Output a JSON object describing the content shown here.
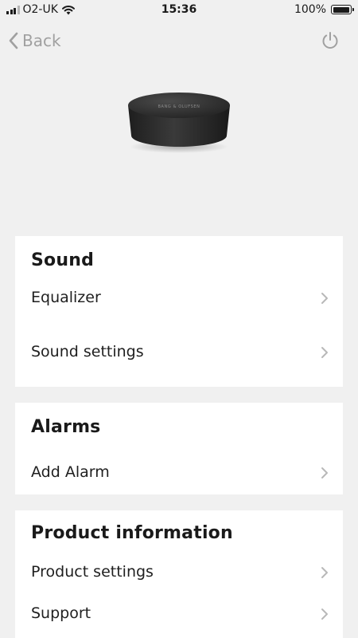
{
  "status_bar": {
    "carrier": "O2-UK",
    "time": "15:36",
    "battery_percent": "100%",
    "battery_level": 1.0,
    "signal_bars": 3,
    "icons": [
      "signal-icon",
      "wifi-icon",
      "battery-icon"
    ]
  },
  "nav": {
    "back_label": "Back",
    "power_icon": "power-icon",
    "back_icon": "chevron-left-icon",
    "color_muted": "#a0a0a0"
  },
  "product": {
    "brand_text": "BANG & OLUFSEN"
  },
  "sections": {
    "sound": {
      "title": "Sound",
      "items": [
        {
          "label": "Equalizer"
        },
        {
          "label": "Sound settings"
        }
      ]
    },
    "alarms": {
      "title": "Alarms",
      "items": [
        {
          "label": "Add Alarm"
        }
      ]
    },
    "product_information": {
      "title": "Product information",
      "items": [
        {
          "label": "Product settings"
        },
        {
          "label": "Support"
        }
      ]
    }
  },
  "colors": {
    "background": "#f0f0f0",
    "card": "#ffffff",
    "chevron": "#b8b8b8"
  }
}
